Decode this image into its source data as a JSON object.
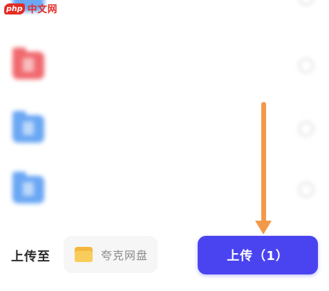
{
  "watermark": {
    "logo_text": "php",
    "site_text": "中文网"
  },
  "file_list": [
    {
      "name": "",
      "meta": "",
      "icon": "folder-icon",
      "color": "#6aa7f4",
      "blurred": true
    },
    {
      "name": "",
      "meta": "",
      "icon": "pdf-file-icon",
      "color": "#f06a6f",
      "blurred": true
    },
    {
      "name": "",
      "meta": "",
      "icon": "document-file-icon",
      "color": "#6aa7f4",
      "blurred": true
    },
    {
      "name": "",
      "meta": "",
      "icon": "document-file-icon",
      "color": "#6aa7f4",
      "blurred": true
    }
  ],
  "bottom_bar": {
    "upload_to_label": "上传至",
    "destination": {
      "label": "夸克网盘",
      "icon": "folder-icon"
    },
    "upload_button": {
      "label": "上传（1）",
      "color": "#4a44f0"
    }
  },
  "annotation": {
    "arrow_color": "#f39a4a",
    "arrow_direction": "down"
  }
}
